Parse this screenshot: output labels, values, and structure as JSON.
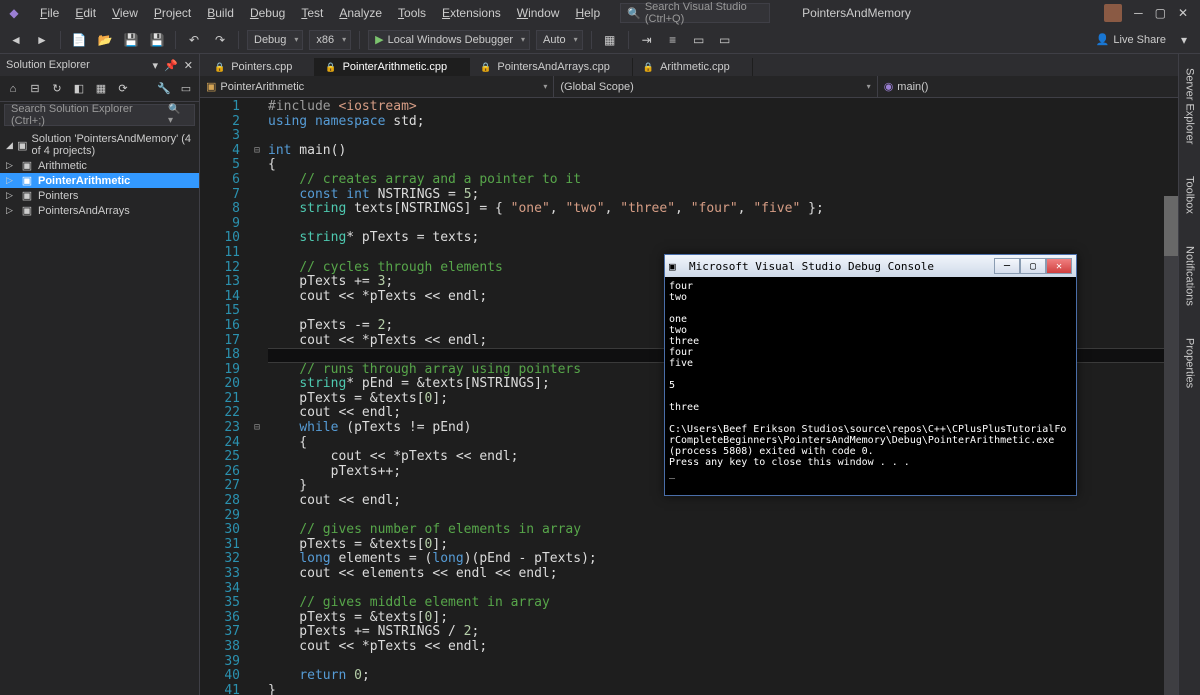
{
  "menu": {
    "items": [
      "File",
      "Edit",
      "View",
      "Project",
      "Build",
      "Debug",
      "Test",
      "Analyze",
      "Tools",
      "Extensions",
      "Window",
      "Help"
    ]
  },
  "search": {
    "placeholder": "Search Visual Studio (Ctrl+Q)"
  },
  "app_title": "PointersAndMemory",
  "live_share": "Live Share",
  "toolbar": {
    "config": "Debug",
    "platform": "x86",
    "debugger": "Local Windows Debugger",
    "auto": "Auto"
  },
  "solution_explorer": {
    "title": "Solution Explorer",
    "search_placeholder": "Search Solution Explorer (Ctrl+;)",
    "solution": "Solution 'PointersAndMemory' (4 of 4 projects)",
    "projects": [
      "Arithmetic",
      "PointerArithmetic",
      "Pointers",
      "PointersAndArrays"
    ]
  },
  "tabs": [
    "Pointers.cpp",
    "PointerArithmetic.cpp",
    "PointersAndArrays.cpp",
    "Arithmetic.cpp"
  ],
  "navbar": {
    "project": "PointerArithmetic",
    "scope": "(Global Scope)",
    "func": "main()"
  },
  "code": [
    {
      "n": 1,
      "h": "<span class='inc'>#include</span> <span class='str'>&lt;iostream&gt;</span>"
    },
    {
      "n": 2,
      "h": "<span class='kw'>using</span> <span class='kw'>namespace</span> std;"
    },
    {
      "n": 3,
      "h": ""
    },
    {
      "n": 4,
      "h": "<span class='kw'>int</span> main()",
      "fold": "⊟"
    },
    {
      "n": 5,
      "h": "{"
    },
    {
      "n": 6,
      "h": "    <span class='com'>// creates array and a pointer to it</span>"
    },
    {
      "n": 7,
      "h": "    <span class='kw'>const</span> <span class='kw'>int</span> NSTRINGS = <span class='num'>5</span>;"
    },
    {
      "n": 8,
      "h": "    <span class='type'>string</span> texts[NSTRINGS] = { <span class='str'>\"one\"</span>, <span class='str'>\"two\"</span>, <span class='str'>\"three\"</span>, <span class='str'>\"four\"</span>, <span class='str'>\"five\"</span> };"
    },
    {
      "n": 9,
      "h": ""
    },
    {
      "n": 10,
      "h": "    <span class='type'>string</span>* pTexts = texts;"
    },
    {
      "n": 11,
      "h": ""
    },
    {
      "n": 12,
      "h": "    <span class='com'>// cycles through elements</span>"
    },
    {
      "n": 13,
      "h": "    pTexts += <span class='num'>3</span>;"
    },
    {
      "n": 14,
      "h": "    cout &lt;&lt; *pTexts &lt;&lt; endl;"
    },
    {
      "n": 15,
      "h": ""
    },
    {
      "n": 16,
      "h": "    pTexts -= <span class='num'>2</span>;"
    },
    {
      "n": 17,
      "h": "    cout &lt;&lt; *pTexts &lt;&lt; endl;"
    },
    {
      "n": 18,
      "h": "",
      "hl": true
    },
    {
      "n": 19,
      "h": "    <span class='com'>// runs through array using pointers</span>"
    },
    {
      "n": 20,
      "h": "    <span class='type'>string</span>* pEnd = &amp;texts[NSTRINGS];"
    },
    {
      "n": 21,
      "h": "    pTexts = &amp;texts[<span class='num'>0</span>];"
    },
    {
      "n": 22,
      "h": "    cout &lt;&lt; endl;"
    },
    {
      "n": 23,
      "h": "    <span class='kw'>while</span> (pTexts != pEnd)",
      "fold": "⊟"
    },
    {
      "n": 24,
      "h": "    {"
    },
    {
      "n": 25,
      "h": "        cout &lt;&lt; *pTexts &lt;&lt; endl;"
    },
    {
      "n": 26,
      "h": "        pTexts++;"
    },
    {
      "n": 27,
      "h": "    }"
    },
    {
      "n": 28,
      "h": "    cout &lt;&lt; endl;"
    },
    {
      "n": 29,
      "h": ""
    },
    {
      "n": 30,
      "h": "    <span class='com'>// gives number of elements in array</span>"
    },
    {
      "n": 31,
      "h": "    pTexts = &amp;texts[<span class='num'>0</span>];"
    },
    {
      "n": 32,
      "h": "    <span class='kw'>long</span> elements = (<span class='kw'>long</span>)(pEnd - pTexts);"
    },
    {
      "n": 33,
      "h": "    cout &lt;&lt; elements &lt;&lt; endl &lt;&lt; endl;"
    },
    {
      "n": 34,
      "h": ""
    },
    {
      "n": 35,
      "h": "    <span class='com'>// gives middle element in array</span>"
    },
    {
      "n": 36,
      "h": "    pTexts = &amp;texts[<span class='num'>0</span>];"
    },
    {
      "n": 37,
      "h": "    pTexts += NSTRINGS / <span class='num'>2</span>;"
    },
    {
      "n": 38,
      "h": "    cout &lt;&lt; *pTexts &lt;&lt; endl;"
    },
    {
      "n": 39,
      "h": ""
    },
    {
      "n": 40,
      "h": "    <span class='kw'>return</span> <span class='num'>0</span>;"
    },
    {
      "n": 41,
      "h": "}"
    }
  ],
  "console": {
    "title": "Microsoft Visual Studio Debug Console",
    "lines": [
      "four",
      "two",
      "",
      "one",
      "two",
      "three",
      "four",
      "five",
      "",
      "5",
      "",
      "three",
      "",
      "C:\\Users\\Beef Erikson Studios\\source\\repos\\C++\\CPlusPlusTutorialForCompleteBeginners\\PointersAndMemory\\Debug\\PointerArithmetic.exe (process 5808) exited with code 0.",
      "Press any key to close this window . . .",
      "_"
    ]
  },
  "side_tabs": [
    "Server Explorer",
    "Toolbox",
    "Notifications",
    "Properties"
  ]
}
